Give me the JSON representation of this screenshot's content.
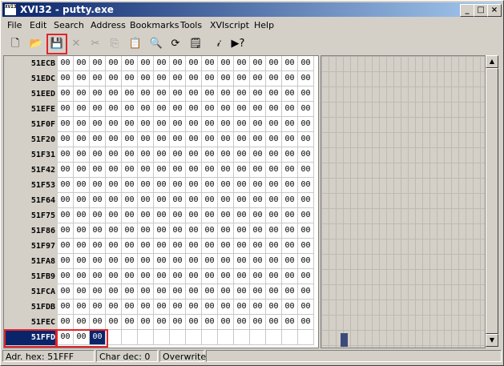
{
  "window": {
    "title": "XVI32 - putty.exe",
    "icon_text": "XVI32",
    "controls": [
      "_",
      "□",
      "×"
    ]
  },
  "menu": [
    "File",
    "Edit",
    "Search",
    "Address",
    "Bookmarks",
    "Tools",
    "XVIscript",
    "Help"
  ],
  "toolbar": [
    {
      "icon": "new-file-icon",
      "glyph": "🗋"
    },
    {
      "icon": "open-folder-icon",
      "glyph": "📂"
    },
    {
      "icon": "save-icon",
      "glyph": "💾",
      "highlighted": true
    },
    {
      "icon": "delete-icon",
      "glyph": "✕",
      "disabled": true
    },
    {
      "icon": "cut-icon",
      "glyph": "✂",
      "disabled": true
    },
    {
      "icon": "copy-icon",
      "glyph": "⎘",
      "disabled": true
    },
    {
      "icon": "paste-icon",
      "glyph": "📋",
      "disabled": true
    },
    {
      "icon": "find-icon",
      "glyph": "🔍"
    },
    {
      "icon": "replace-icon",
      "glyph": "⟳"
    },
    {
      "icon": "properties-icon",
      "glyph": "🗒"
    },
    {
      "icon": "script-icon",
      "glyph": "𝒾"
    },
    {
      "icon": "help-icon",
      "glyph": "▶?"
    }
  ],
  "hex": {
    "columns": 16,
    "rows": [
      {
        "addr": "51ECB",
        "bytes": [
          "00",
          "00",
          "00",
          "00",
          "00",
          "00",
          "00",
          "00",
          "00",
          "00",
          "00",
          "00",
          "00",
          "00",
          "00",
          "00"
        ]
      },
      {
        "addr": "51EDC",
        "bytes": [
          "00",
          "00",
          "00",
          "00",
          "00",
          "00",
          "00",
          "00",
          "00",
          "00",
          "00",
          "00",
          "00",
          "00",
          "00",
          "00"
        ]
      },
      {
        "addr": "51EED",
        "bytes": [
          "00",
          "00",
          "00",
          "00",
          "00",
          "00",
          "00",
          "00",
          "00",
          "00",
          "00",
          "00",
          "00",
          "00",
          "00",
          "00"
        ]
      },
      {
        "addr": "51EFE",
        "bytes": [
          "00",
          "00",
          "00",
          "00",
          "00",
          "00",
          "00",
          "00",
          "00",
          "00",
          "00",
          "00",
          "00",
          "00",
          "00",
          "00"
        ]
      },
      {
        "addr": "51F0F",
        "bytes": [
          "00",
          "00",
          "00",
          "00",
          "00",
          "00",
          "00",
          "00",
          "00",
          "00",
          "00",
          "00",
          "00",
          "00",
          "00",
          "00"
        ]
      },
      {
        "addr": "51F20",
        "bytes": [
          "00",
          "00",
          "00",
          "00",
          "00",
          "00",
          "00",
          "00",
          "00",
          "00",
          "00",
          "00",
          "00",
          "00",
          "00",
          "00"
        ]
      },
      {
        "addr": "51F31",
        "bytes": [
          "00",
          "00",
          "00",
          "00",
          "00",
          "00",
          "00",
          "00",
          "00",
          "00",
          "00",
          "00",
          "00",
          "00",
          "00",
          "00"
        ]
      },
      {
        "addr": "51F42",
        "bytes": [
          "00",
          "00",
          "00",
          "00",
          "00",
          "00",
          "00",
          "00",
          "00",
          "00",
          "00",
          "00",
          "00",
          "00",
          "00",
          "00"
        ]
      },
      {
        "addr": "51F53",
        "bytes": [
          "00",
          "00",
          "00",
          "00",
          "00",
          "00",
          "00",
          "00",
          "00",
          "00",
          "00",
          "00",
          "00",
          "00",
          "00",
          "00"
        ]
      },
      {
        "addr": "51F64",
        "bytes": [
          "00",
          "00",
          "00",
          "00",
          "00",
          "00",
          "00",
          "00",
          "00",
          "00",
          "00",
          "00",
          "00",
          "00",
          "00",
          "00"
        ]
      },
      {
        "addr": "51F75",
        "bytes": [
          "00",
          "00",
          "00",
          "00",
          "00",
          "00",
          "00",
          "00",
          "00",
          "00",
          "00",
          "00",
          "00",
          "00",
          "00",
          "00"
        ]
      },
      {
        "addr": "51F86",
        "bytes": [
          "00",
          "00",
          "00",
          "00",
          "00",
          "00",
          "00",
          "00",
          "00",
          "00",
          "00",
          "00",
          "00",
          "00",
          "00",
          "00"
        ]
      },
      {
        "addr": "51F97",
        "bytes": [
          "00",
          "00",
          "00",
          "00",
          "00",
          "00",
          "00",
          "00",
          "00",
          "00",
          "00",
          "00",
          "00",
          "00",
          "00",
          "00"
        ]
      },
      {
        "addr": "51FA8",
        "bytes": [
          "00",
          "00",
          "00",
          "00",
          "00",
          "00",
          "00",
          "00",
          "00",
          "00",
          "00",
          "00",
          "00",
          "00",
          "00",
          "00"
        ]
      },
      {
        "addr": "51FB9",
        "bytes": [
          "00",
          "00",
          "00",
          "00",
          "00",
          "00",
          "00",
          "00",
          "00",
          "00",
          "00",
          "00",
          "00",
          "00",
          "00",
          "00"
        ]
      },
      {
        "addr": "51FCA",
        "bytes": [
          "00",
          "00",
          "00",
          "00",
          "00",
          "00",
          "00",
          "00",
          "00",
          "00",
          "00",
          "00",
          "00",
          "00",
          "00",
          "00"
        ]
      },
      {
        "addr": "51FDB",
        "bytes": [
          "00",
          "00",
          "00",
          "00",
          "00",
          "00",
          "00",
          "00",
          "00",
          "00",
          "00",
          "00",
          "00",
          "00",
          "00",
          "00"
        ]
      },
      {
        "addr": "51FEC",
        "bytes": [
          "00",
          "00",
          "00",
          "00",
          "00",
          "00",
          "00",
          "00",
          "00",
          "00",
          "00",
          "00",
          "00",
          "00",
          "00",
          "00"
        ]
      },
      {
        "addr": "51FFD",
        "bytes": [
          "00",
          "00",
          "00",
          "",
          "",
          "",
          "",
          "",
          "",
          "",
          "",
          "",
          "",
          "",
          "",
          ""
        ],
        "selected": true,
        "cursor_col": 2
      }
    ]
  },
  "status": {
    "address": "Adr. hex: 51FFF",
    "char": "Char dec: 0",
    "mode": "Overwrite"
  },
  "colors": {
    "selection": "#0a246a",
    "highlight_box": "#e0242b",
    "title_gradient_start": "#0a246a",
    "title_gradient_end": "#a6caf0"
  }
}
